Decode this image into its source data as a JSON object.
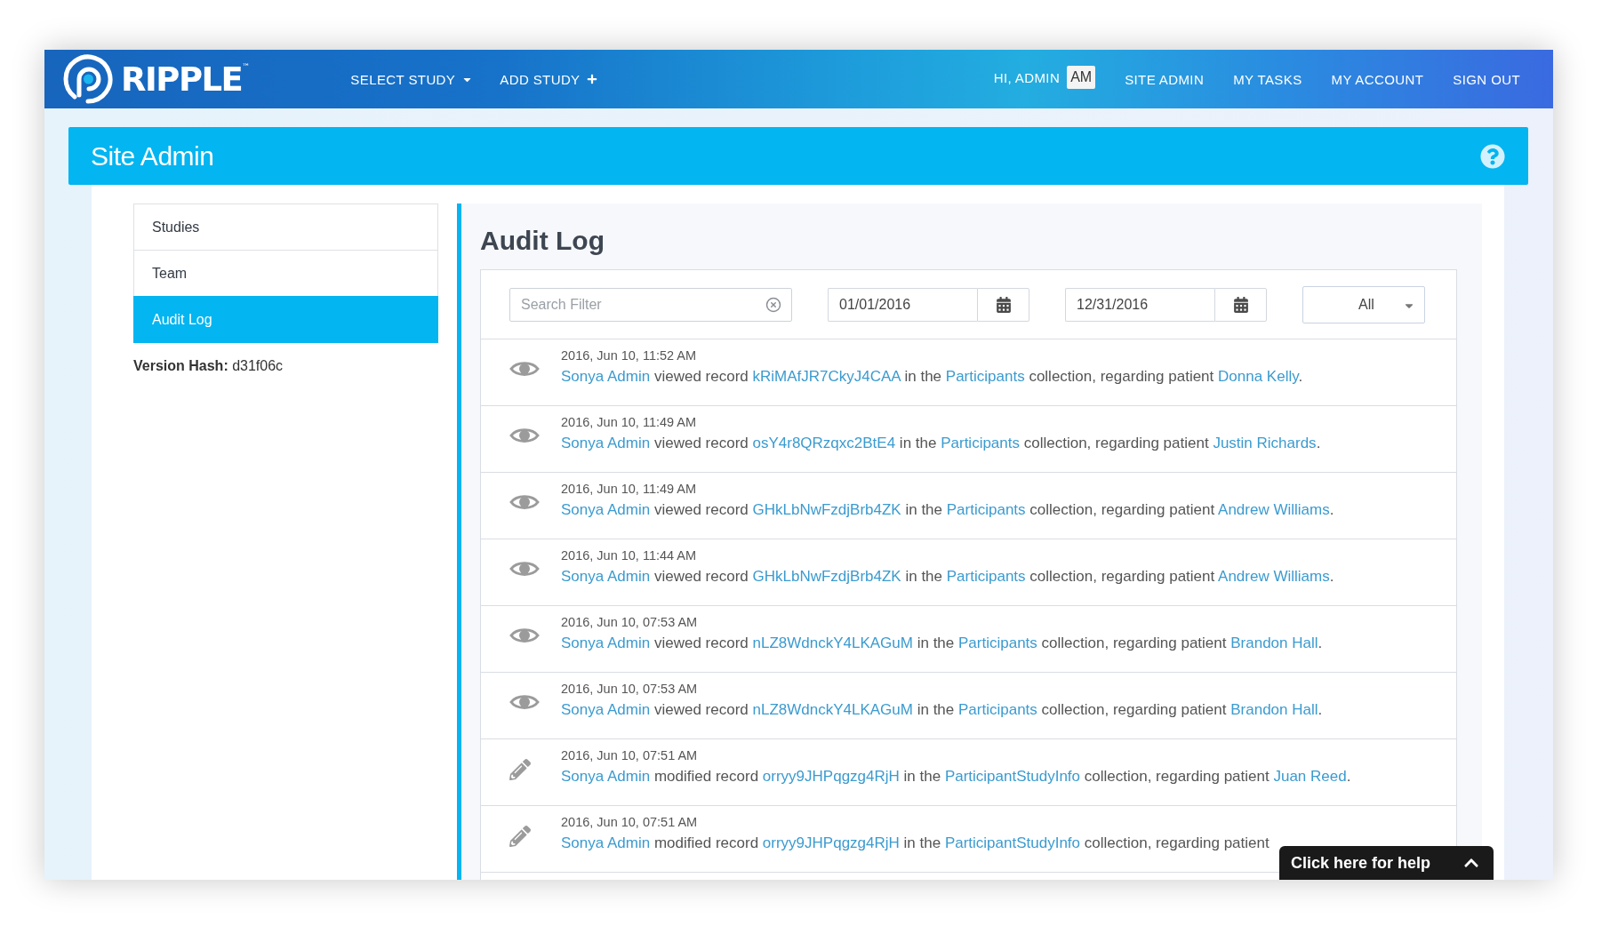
{
  "header": {
    "logo": "RIPPLE$^{™}$",
    "nav": [
      {
        "label": "SELECT STUDY",
        "kind": "dropdown"
      },
      {
        "label": "ADD STUDY",
        "kind": "add"
      }
    ],
    "greeting": "HI, ADMIN",
    "avatar": "AM",
    "links": [
      "SITE ADMIN",
      "MY TASKS",
      "MY ACCOUNT",
      "SIGN OUT"
    ]
  },
  "page_title": "Site Admin",
  "sidebar": {
    "items": [
      {
        "label": "Studies",
        "selected": false
      },
      {
        "label": "Team",
        "selected": false
      },
      {
        "label": "Audit Log",
        "selected": true
      }
    ],
    "version_hash": "**Version Hash:** d31f06c"
  },
  "audit_log": {
    "title": "Audit Log",
    "filters": {
      "search": {
        "placeholder": "Search Filter"
      },
      "start_date": "01/01/2016",
      "end_date": "12/31/2016",
      "type_select": "All"
    },
    "entries": [
      {
        "kind": "view",
        "time": "2016, Jun 10, 11:52 AM",
        "user": "Sonya Admin",
        "action": "viewed record",
        "record": "kRiMAfJR7CkyJ4CAA",
        "in_the": "in the",
        "collection": "Participants",
        "suffix": "collection, regarding patient",
        "patient": "Donna Kelly",
        "end": "."
      },
      {
        "kind": "view",
        "time": "2016, Jun 10, 11:49 AM",
        "user": "Sonya Admin",
        "action": "viewed record",
        "record": "osY4r8QRzqxc2BtE4",
        "in_the": "in the",
        "collection": "Participants",
        "suffix": "collection, regarding patient",
        "patient": "Justin Richards",
        "end": "."
      },
      {
        "kind": "view",
        "time": "2016, Jun 10, 11:49 AM",
        "user": "Sonya Admin",
        "action": "viewed record",
        "record": "GHkLbNwFzdjBrb4ZK",
        "in_the": "in the",
        "collection": "Participants",
        "suffix": "collection, regarding patient",
        "patient": "Andrew Williams",
        "end": "."
      },
      {
        "kind": "view",
        "time": "2016, Jun 10, 11:44 AM",
        "user": "Sonya Admin",
        "action": "viewed record",
        "record": "GHkLbNwFzdjBrb4ZK",
        "in_the": "in the",
        "collection": "Participants",
        "suffix": "collection, regarding patient",
        "patient": "Andrew Williams",
        "end": "."
      },
      {
        "kind": "view",
        "time": "2016, Jun 10, 07:53 AM",
        "user": "Sonya Admin",
        "action": "viewed record",
        "record": "nLZ8WdnckY4LKAGuM",
        "in_the": "in the",
        "collection": "Participants",
        "suffix": "collection, regarding patient",
        "patient": "Brandon Hall",
        "end": "."
      },
      {
        "kind": "view",
        "time": "2016, Jun 10, 07:53 AM",
        "user": "Sonya Admin",
        "action": "viewed record",
        "record": "nLZ8WdnckY4LKAGuM",
        "in_the": "in the",
        "collection": "Participants",
        "suffix": "collection, regarding patient",
        "patient": "Brandon Hall",
        "end": "."
      },
      {
        "kind": "edit",
        "time": "2016, Jun 10, 07:51 AM",
        "user": "Sonya Admin",
        "action": "modified record",
        "record": "orryy9JHPqgzg4RjH",
        "in_the": "in the",
        "collection": "ParticipantStudyInfo",
        "suffix": "collection, regarding patient",
        "patient": "Juan Reed",
        "end": "."
      },
      {
        "kind": "edit",
        "time": "2016, Jun 10, 07:51 AM",
        "user": "Sonya Admin",
        "action": "modified record",
        "record": "orryy9JHPqgzg4RjH",
        "in_the": "in the",
        "collection": "ParticipantStudyInfo",
        "suffix": "collection, regarding patient"
      }
    ]
  },
  "help_tab": {
    "label": "Click here for help"
  }
}
